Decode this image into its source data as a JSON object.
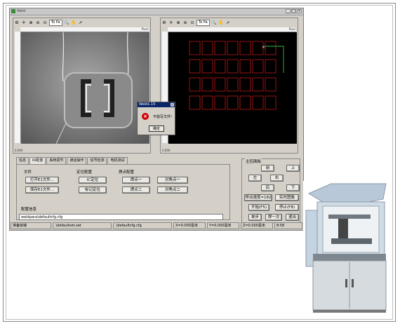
{
  "window": {
    "title": "Weld"
  },
  "pane_toolbar": {
    "zoom_select": "To Pa"
  },
  "ruler": {
    "start": "0.000",
    "end_label": "Pixel"
  },
  "tabs": [
    {
      "label": "信息"
    },
    {
      "label": "IO配置"
    },
    {
      "label": "系统调节"
    },
    {
      "label": "通话操作"
    },
    {
      "label": "信号检测"
    },
    {
      "label": "电机测试"
    }
  ],
  "file_group": {
    "title": "文件",
    "open_btn": "打开E1文件...",
    "save_btn": "保存E1文件..."
  },
  "locate_group": {
    "title": "定位配置",
    "ic_btn": "IC定位",
    "mark_btn": "标记定位"
  },
  "weld_group": {
    "title": "焊点配置",
    "p1": "焊点一",
    "p2": "焊点二",
    "c1": "对角点一",
    "c2": "对角点二"
  },
  "config": {
    "title": "配置信息",
    "path": "weldpara\\defaultcfg.cfg"
  },
  "control": {
    "title": "主控面板",
    "front": "前",
    "up": "上",
    "left": "左",
    "right": "右",
    "back": "后",
    "down": "下",
    "speed": "移动速度=182",
    "realtime": "实时图像",
    "start": "开始(F5)",
    "stop": "停止(F8)",
    "single": "单步",
    "weld_once": "焊一次",
    "exit": "退出"
  },
  "status": {
    "ready": "准备就绪",
    "set_file": ".\\defaultset.set",
    "cfg_file": ".\\defaultcfg.cfg",
    "x": "X=0.000毫米",
    "y": "Y=0.000毫米",
    "z": "Z=0.000毫米",
    "time": "8:58"
  },
  "dialog": {
    "title": "Weld1.15",
    "message": "不能写文件!",
    "ok": "确定"
  },
  "colors": {
    "grid_red": "#c01818",
    "path_green": "#30c030",
    "view_bg": "#000000"
  }
}
